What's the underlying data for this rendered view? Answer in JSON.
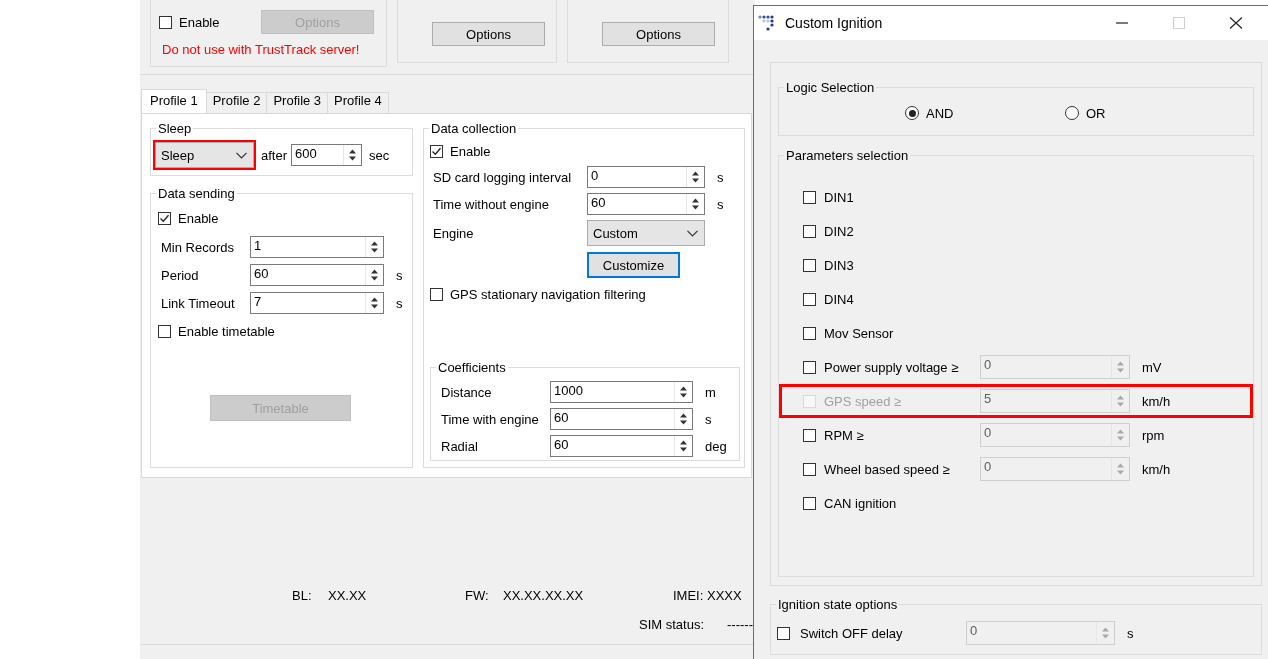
{
  "main_window": {
    "top_groups": [
      {
        "enable": {
          "label": "Enable",
          "checked": false
        },
        "button": {
          "label": "Options",
          "disabled": true
        },
        "warning": "Do not use with TrustTrack server!"
      },
      {
        "button": {
          "label": "Options",
          "disabled": false
        }
      },
      {
        "button": {
          "label": "Options",
          "disabled": false
        }
      }
    ],
    "tabs": [
      {
        "label": "Profile 1",
        "selected": true
      },
      {
        "label": "Profile 2",
        "selected": false
      },
      {
        "label": "Profile 3",
        "selected": false
      },
      {
        "label": "Profile 4",
        "selected": false
      }
    ],
    "sleep": {
      "title": "Sleep",
      "mode": {
        "value": "Sleep",
        "highlighted": true
      },
      "after_label": "after",
      "value": "600",
      "unit": "sec"
    },
    "data_sending": {
      "title": "Data sending",
      "enable": {
        "label": "Enable",
        "checked": true
      },
      "fields": [
        {
          "label": "Min Records",
          "value": "1"
        },
        {
          "label": "Period",
          "value": "60",
          "unit": "s"
        },
        {
          "label": "Link Timeout",
          "value": "7",
          "unit": "s"
        }
      ],
      "timetable_check": {
        "label": "Enable timetable",
        "checked": false
      },
      "timetable_button": {
        "label": "Timetable",
        "disabled": true
      }
    },
    "data_collection": {
      "title": "Data collection",
      "enable": {
        "label": "Enable",
        "checked": true
      },
      "rows": [
        {
          "kind": "spin",
          "label": "SD card logging interval",
          "value": "0",
          "unit": "s"
        },
        {
          "kind": "spin",
          "label": "Time without engine",
          "value": "60",
          "unit": "s"
        },
        {
          "kind": "combo",
          "label": "Engine",
          "value": "Custom"
        }
      ],
      "customize_button": {
        "label": "Customize",
        "disabled": false,
        "focused": true
      },
      "gps_filter": {
        "label": "GPS stationary navigation filtering",
        "checked": false
      },
      "coefficients": {
        "title": "Coefficients",
        "rows": [
          {
            "label": "Distance",
            "value": "1000",
            "unit": "m"
          },
          {
            "label": "Time with engine",
            "value": "60",
            "unit": "s"
          },
          {
            "label": "Radial",
            "value": "60",
            "unit": "deg"
          }
        ]
      }
    },
    "status": [
      {
        "label": "BL:",
        "value": "XX.XX"
      },
      {
        "label": "FW:",
        "value": "XX.XX.XX.XX"
      },
      {
        "label": "IMEI:",
        "value": "XXXX"
      }
    ],
    "sim": {
      "label": "SIM status:",
      "value": "------"
    }
  },
  "dialog": {
    "title": "Custom Ignition",
    "logic": {
      "title": "Logic Selection",
      "options": [
        {
          "label": "AND",
          "selected": true
        },
        {
          "label": "OR",
          "selected": false
        }
      ]
    },
    "parameters": {
      "title": "Parameters selection",
      "items": [
        {
          "label": "DIN1",
          "checked": false,
          "disabled": false
        },
        {
          "label": "DIN2",
          "checked": false,
          "disabled": false
        },
        {
          "label": "DIN3",
          "checked": false,
          "disabled": false
        },
        {
          "label": "DIN4",
          "checked": false,
          "disabled": false
        },
        {
          "label": "Mov Sensor",
          "checked": false,
          "disabled": false
        },
        {
          "label": "Power supply voltage ≥",
          "checked": false,
          "disabled": false,
          "value": "0",
          "unit": "mV",
          "field_disabled": true
        },
        {
          "label": "GPS speed ≥",
          "checked": false,
          "disabled": true,
          "highlighted": true,
          "value": "5",
          "unit": "km/h",
          "field_disabled": true
        },
        {
          "label": "RPM ≥",
          "checked": false,
          "disabled": false,
          "value": "0",
          "unit": "rpm",
          "field_disabled": true
        },
        {
          "label": "Wheel based speed ≥",
          "checked": false,
          "disabled": false,
          "value": "0",
          "unit": "km/h",
          "field_disabled": true
        },
        {
          "label": "CAN ignition",
          "checked": false,
          "disabled": false
        }
      ]
    },
    "ignition_options": {
      "title": "Ignition state options",
      "switch_off": {
        "label": "Switch OFF delay",
        "checked": false
      },
      "value": "0",
      "field_disabled": true,
      "unit": "s"
    }
  }
}
